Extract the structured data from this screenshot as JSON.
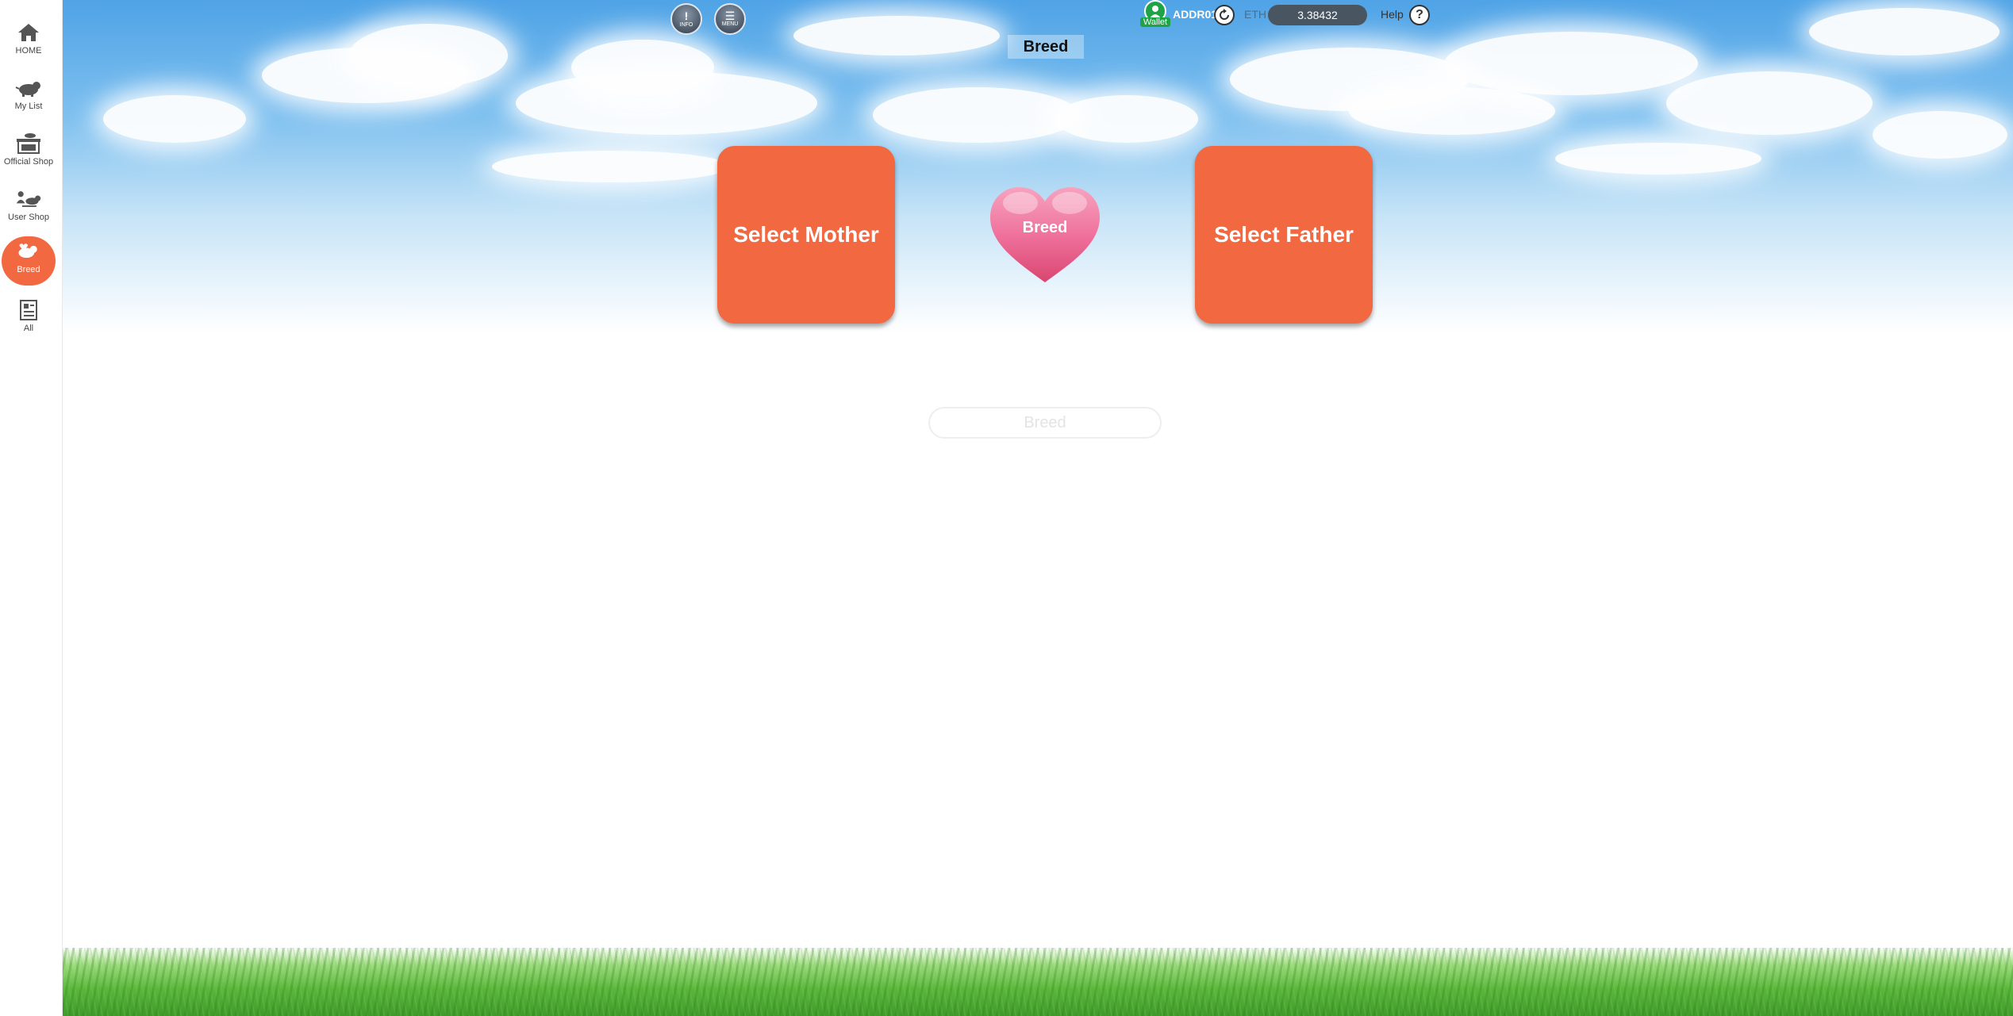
{
  "sidebar": {
    "items": [
      {
        "label": "HOME",
        "icon": "home-icon",
        "active": false
      },
      {
        "label": "My List",
        "icon": "pet-icon",
        "active": false
      },
      {
        "label": "Official Shop",
        "icon": "shop-icon",
        "active": false
      },
      {
        "label": "User Shop",
        "icon": "user-shop-icon",
        "active": false
      },
      {
        "label": "Breed",
        "icon": "breed-icon",
        "active": true
      },
      {
        "label": "All",
        "icon": "document-icon",
        "active": false
      }
    ]
  },
  "header": {
    "info_label": "INFO",
    "menu_label": "MENU",
    "page_title": "Breed",
    "wallet_label": "Wallet",
    "address": "ADDR01",
    "currency_label": "ETH",
    "balance": "3.38432",
    "help_label": "Help",
    "help_icon_glyph": "?"
  },
  "main": {
    "select_mother": "Select Mother",
    "heart_label": "Breed",
    "select_father": "Select Father",
    "breed_button": "Breed"
  },
  "colors": {
    "accent": "#f26841",
    "heart": "#f0709a",
    "wallet_green": "#1fa347",
    "balance_bg": "#4a5562"
  }
}
